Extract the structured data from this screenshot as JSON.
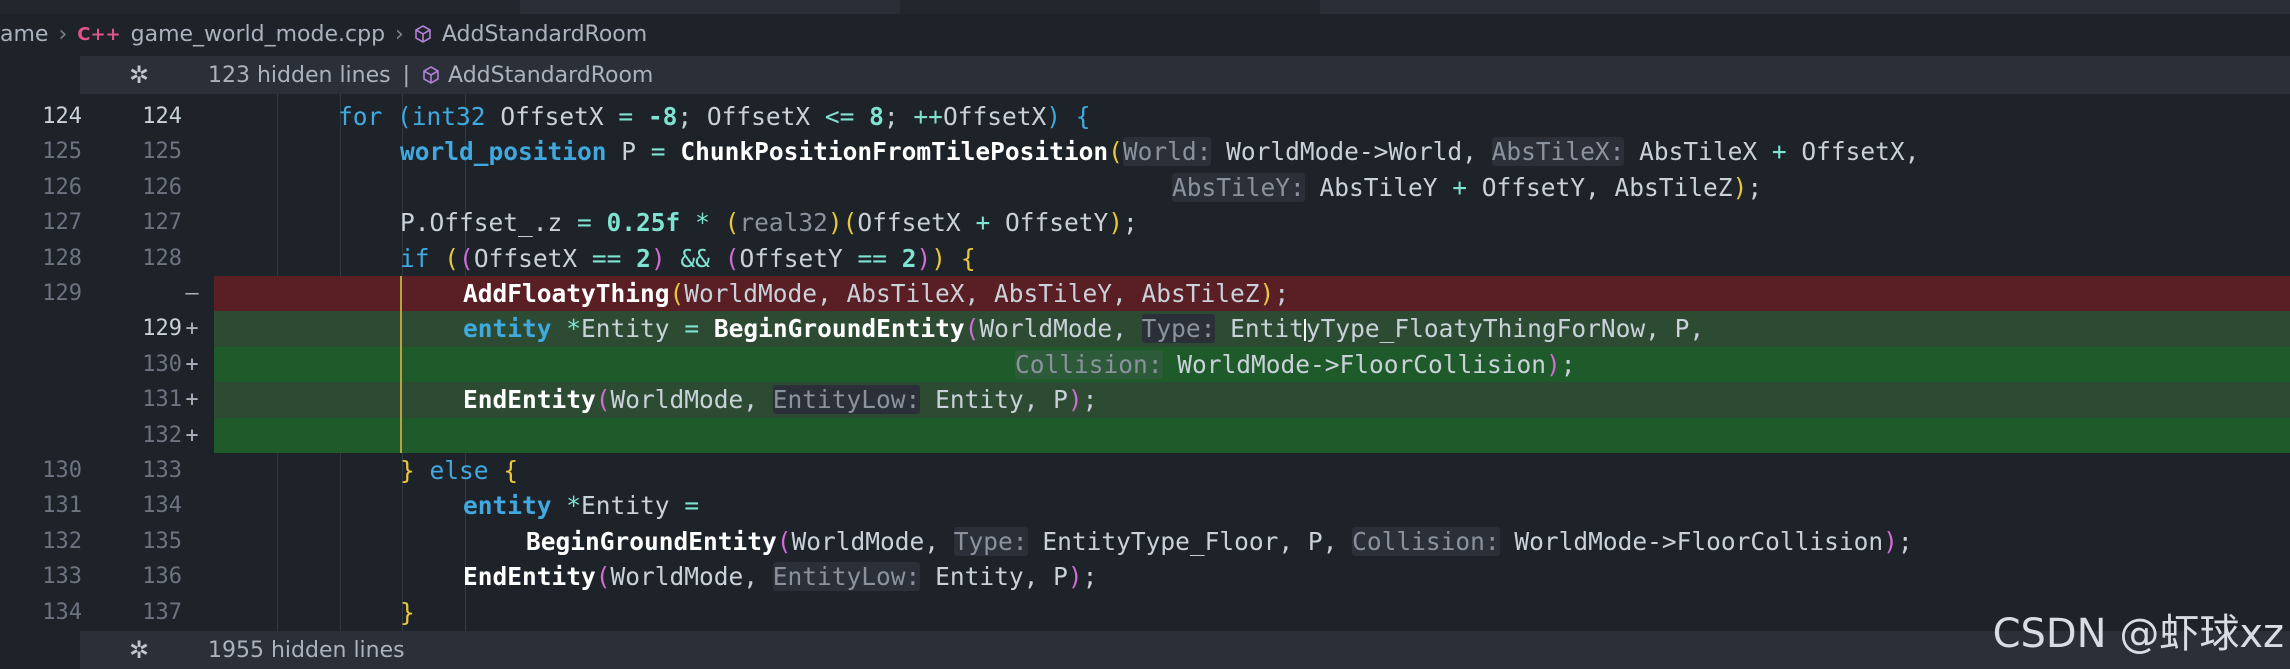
{
  "breadcrumb": {
    "items": [
      "ame",
      "game_world_mode.cpp",
      "AddStandardRoom"
    ],
    "file_icon": "cpp-file-icon",
    "symbol_icon": "method-cube-icon"
  },
  "fold_top": {
    "label": "123 hidden lines",
    "separator": "|",
    "symbol": "AddStandardRoom"
  },
  "fold_bottom": {
    "label": "1955 hidden lines"
  },
  "lines": [
    {
      "old": "124",
      "new": "124",
      "mark": ""
    },
    {
      "old": "125",
      "new": "125",
      "mark": ""
    },
    {
      "old": "126",
      "new": "126",
      "mark": ""
    },
    {
      "old": "127",
      "new": "127",
      "mark": ""
    },
    {
      "old": "128",
      "new": "128",
      "mark": ""
    },
    {
      "old": "129",
      "new": "",
      "mark": "—"
    },
    {
      "old": "",
      "new": "129",
      "mark": "+"
    },
    {
      "old": "",
      "new": "130",
      "mark": "+"
    },
    {
      "old": "",
      "new": "131",
      "mark": "+"
    },
    {
      "old": "",
      "new": "132",
      "mark": "+"
    },
    {
      "old": "130",
      "new": "133",
      "mark": ""
    },
    {
      "old": "131",
      "new": "134",
      "mark": ""
    },
    {
      "old": "132",
      "new": "135",
      "mark": ""
    },
    {
      "old": "133",
      "new": "136",
      "mark": ""
    },
    {
      "old": "134",
      "new": "137",
      "mark": ""
    }
  ],
  "code": {
    "l1": {
      "for": "for",
      "p1": "(",
      "int32": "int32",
      "a": " OffsetX ",
      "eq": "=",
      "neg": " -8",
      "b": "; OffsetX ",
      "le": "<=",
      "n8": " 8",
      "c": "; ",
      "inc": "++",
      "d": "OffsetX",
      "p2": ")",
      "e": " ",
      "brace": "{"
    },
    "l2": {
      "type": "world_position",
      "a": " P ",
      "eq": "=",
      "sp": " ",
      "fn": "ChunkPositionFromTilePosition",
      "p1": "(",
      "h1": "World:",
      "b": " WorldMode->World, ",
      "h2": "AbsTileX:",
      "c": " AbsTileX ",
      "plus": "+",
      "d": " OffsetX,"
    },
    "l3": {
      "h": "AbsTileY:",
      "a": " AbsTileY ",
      "plus": "+",
      "b": " OffsetY, AbsTileZ",
      "p2": ")",
      "semi": ";"
    },
    "l4": {
      "a": "P.Offset_.z ",
      "eq": "=",
      "sp": " ",
      "num": "0.25f",
      "sp2": " ",
      "mul": "*",
      "sp3": " ",
      "p1": "(",
      "real": "real32",
      "p2": ")",
      "p3": "(",
      "b": "OffsetX ",
      "plus": "+",
      "c": " OffsetY",
      "p4": ")",
      "semi": ";"
    },
    "l5": {
      "if": "if",
      "sp": " ",
      "p1": "(",
      "p2": "(",
      "a": "OffsetX ",
      "eq": "==",
      "sp2": " ",
      "n2": "2",
      "p3": ")",
      "sp3": " ",
      "and": "&&",
      "sp4": " ",
      "p4": "(",
      "b": "OffsetY ",
      "eq2": "==",
      "sp5": " ",
      "n2b": "2",
      "p5": ")",
      "p6": ")",
      "sp6": " ",
      "brace": "{"
    },
    "l6": {
      "fn": "AddFloatyThing",
      "p1": "(",
      "a": "WorldMode, AbsTileX, AbsTileY, AbsTileZ",
      "p2": ")",
      "semi": ";"
    },
    "l7": {
      "type": "entity",
      "sp": " ",
      "star": "*",
      "a": "Entity ",
      "eq": "=",
      "sp2": " ",
      "fn": "BeginGroundEntity",
      "p1": "(",
      "b": "WorldMode, ",
      "h": "Type:",
      "c1": " Entit",
      "c2": "yType_FloatyThingForNow, P,"
    },
    "l8": {
      "h": "Collision:",
      "a": " WorldMode->FloorCollision",
      "p2": ")",
      "semi": ";"
    },
    "l9": {
      "fn": "EndEntity",
      "p1": "(",
      "a": "WorldMode, ",
      "h": "EntityLow:",
      "b": " Entity, P",
      "p2": ")",
      "semi": ";"
    },
    "l11": {
      "brace": "}",
      "sp": " ",
      "else": "else",
      "sp2": " ",
      "brace2": "{"
    },
    "l12": {
      "type": "entity",
      "sp": " ",
      "star": "*",
      "a": "Entity ",
      "eq": "="
    },
    "l13": {
      "fn": "BeginGroundEntity",
      "p1": "(",
      "a": "WorldMode, ",
      "h1": "Type:",
      "b": " EntityType_Floor, P, ",
      "h2": "Collision:",
      "c": " WorldMode->FloorCollision",
      "p2": ")",
      "semi": ";"
    },
    "l14": {
      "fn": "EndEntity",
      "p1": "(",
      "a": "WorldMode, ",
      "h": "EntityLow:",
      "b": " Entity, P",
      "p2": ")",
      "semi": ";"
    },
    "l15": {
      "brace": "}"
    }
  },
  "watermark": "CSDN @虾球xz",
  "colors": {
    "background": "#1e2229",
    "deleted": "#5a1f24",
    "added": "#1f5a2a",
    "keyword": "#3fa9e0",
    "number": "#7fe3d2",
    "bracket": "#e8c83a"
  }
}
